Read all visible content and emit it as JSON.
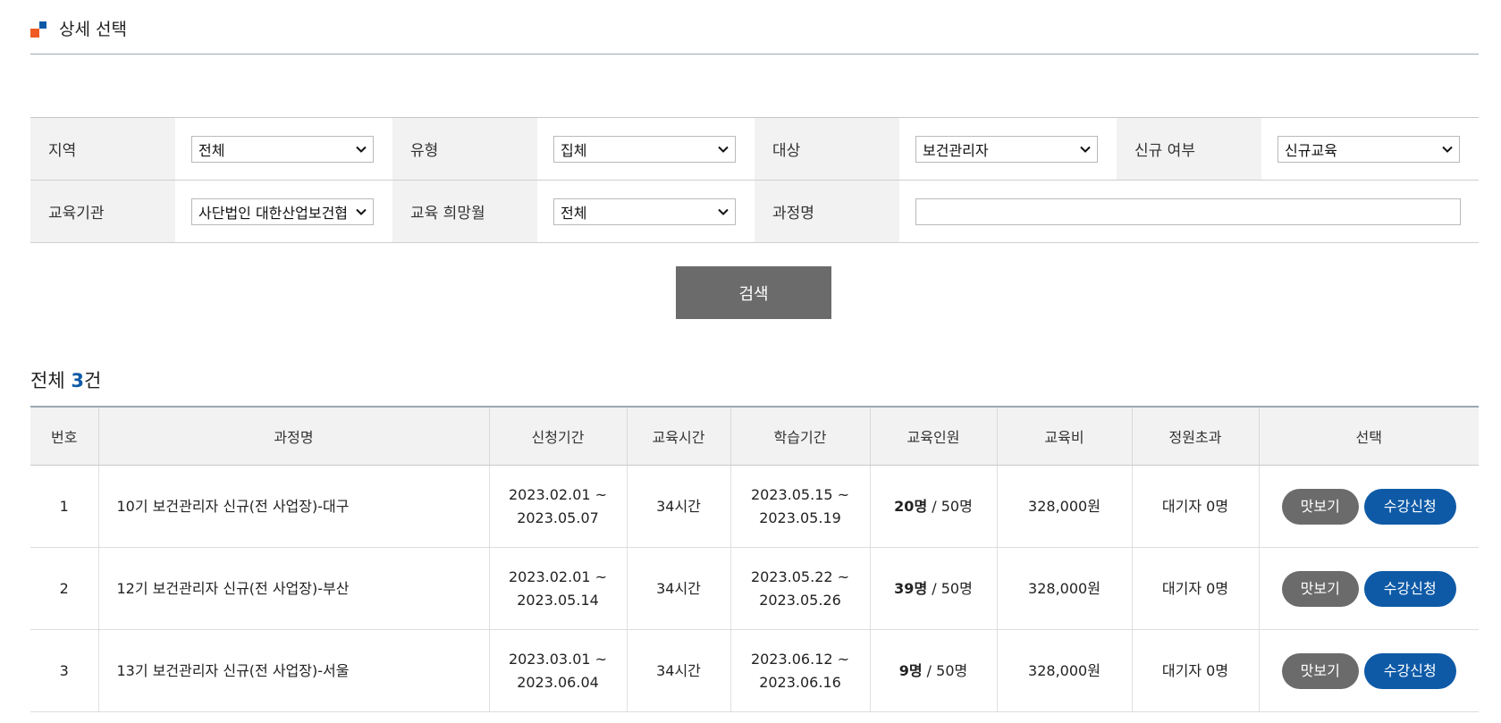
{
  "section": {
    "title": "상세 선택"
  },
  "filters": {
    "region": {
      "label": "지역",
      "value": "전체"
    },
    "type": {
      "label": "유형",
      "value": "집체"
    },
    "target": {
      "label": "대상",
      "value": "보건관리자"
    },
    "new_flag": {
      "label": "신규 여부",
      "value": "신규교육"
    },
    "institution": {
      "label": "교육기관",
      "value": "사단법인 대한산업보건협"
    },
    "month": {
      "label": "교육 희망월",
      "value": "전체"
    },
    "course_name": {
      "label": "과정명",
      "value": ""
    }
  },
  "search_button": "검색",
  "total": {
    "prefix": "전체 ",
    "count": "3",
    "suffix": "건"
  },
  "table": {
    "headers": [
      "번호",
      "과정명",
      "신청기간",
      "교육시간",
      "학습기간",
      "교육인원",
      "교육비",
      "정원초과",
      "선택"
    ],
    "rows": [
      {
        "no": "1",
        "course": "10기 보건관리자 신규(전 사업장)-대구",
        "apply_start": "2023.02.01 ~",
        "apply_end": "2023.05.07",
        "hours": "34시간",
        "study_start": "2023.05.15 ~",
        "study_end": "2023.05.19",
        "enrolled": "20명",
        "capacity": " / 50명",
        "fee": "328,000원",
        "waitlist": "대기자 0명",
        "preview": "맛보기",
        "apply": "수강신청"
      },
      {
        "no": "2",
        "course": "12기 보건관리자 신규(전 사업장)-부산",
        "apply_start": "2023.02.01 ~",
        "apply_end": "2023.05.14",
        "hours": "34시간",
        "study_start": "2023.05.22 ~",
        "study_end": "2023.05.26",
        "enrolled": "39명",
        "capacity": " / 50명",
        "fee": "328,000원",
        "waitlist": "대기자 0명",
        "preview": "맛보기",
        "apply": "수강신청"
      },
      {
        "no": "3",
        "course": "13기 보건관리자 신규(전 사업장)-서울",
        "apply_start": "2023.03.01 ~",
        "apply_end": "2023.06.04",
        "hours": "34시간",
        "study_start": "2023.06.12 ~",
        "study_end": "2023.06.16",
        "enrolled": "9명",
        "capacity": " / 50명",
        "fee": "328,000원",
        "waitlist": "대기자 0명",
        "preview": "맛보기",
        "apply": "수강신청"
      }
    ]
  },
  "colors": {
    "accent_blue": "#0e5aa7",
    "accent_orange": "#f05a24",
    "button_gray": "#6b6b6b"
  }
}
